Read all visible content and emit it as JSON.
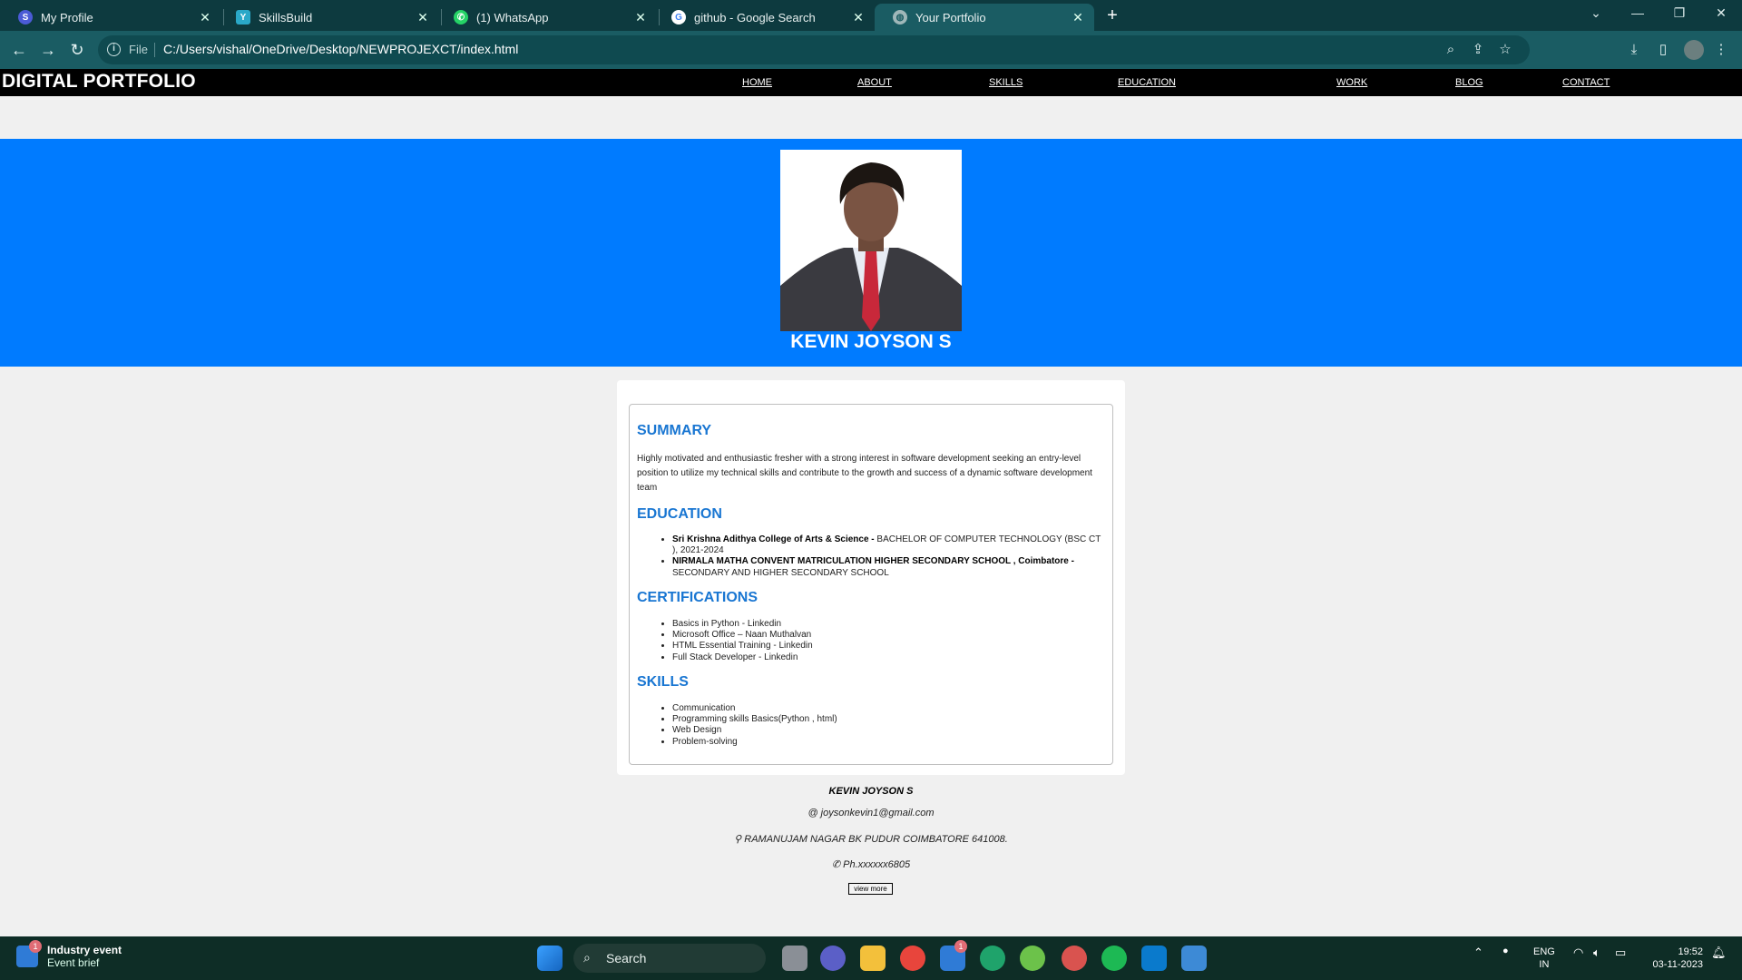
{
  "browser": {
    "tabs": [
      {
        "title": "My Profile",
        "icon": "skillsbuild-icon",
        "color": "#4b5bd6"
      },
      {
        "title": "SkillsBuild",
        "icon": "yl-logo-icon",
        "color": "#2aa8c8"
      },
      {
        "title": "(1) WhatsApp",
        "icon": "whatsapp-icon",
        "color": "#25d366"
      },
      {
        "title": "github - Google Search",
        "icon": "google-icon",
        "color": "#ffffff"
      },
      {
        "title": "Your Portfolio",
        "icon": "globe-icon",
        "color": "#9fb7b9"
      }
    ],
    "address": {
      "scheme": "File",
      "url": "C:/Users/vishal/OneDrive/Desktop/NEWPROJEXCT/index.html"
    }
  },
  "site": {
    "brand": "DIGITAL PORTFOLIO",
    "nav": [
      "HOME",
      "ABOUT",
      "SKILLS",
      "EDUCATION",
      "WORK",
      "BLOG",
      "CONTACT"
    ],
    "hero_name": "KEVIN JOYSON S",
    "colors": {
      "hero": "#007bff",
      "heading": "#1976d2",
      "navbar": "#000000"
    },
    "summary": {
      "heading": "SUMMARY",
      "text": "Highly motivated and enthusiastic fresher with a strong interest in software development seeking an entry-level position to utilize my technical skills and contribute to the growth and success of a dynamic software development team"
    },
    "education": {
      "heading": "EDUCATION",
      "items": [
        {
          "name": "Sri Krishna Adithya College of Arts & Science -",
          "detail": " BACHELOR OF COMPUTER TECHNOLOGY (BSC CT ), 2021-2024"
        },
        {
          "name": "NIRMALA MATHA CONVENT MATRICULATION HIGHER SECONDARY SCHOOL , Coimbatore -",
          "detail": " SECONDARY AND HIGHER SECONDARY SCHOOL"
        }
      ]
    },
    "certifications": {
      "heading": "CERTIFICATIONS",
      "items": [
        "Basics in Python - Linkedin",
        "Microsoft Office – Naan Muthalvan",
        "HTML Essential Training - Linkedin",
        "Full Stack Developer - Linkedin"
      ]
    },
    "skills": {
      "heading": "SKILLS",
      "items": [
        "Communication",
        "Programming skills Basics(Python , html)",
        "Web Design",
        "Problem-solving"
      ]
    },
    "footer": {
      "name": "KEVIN JOYSON S",
      "email": "@ joysonkevin1@gmail.com",
      "address": "⚲ RAMANUJAM NAGAR BK PUDUR COIMBATORE 641008.",
      "phone": "✆ Ph.xxxxxx6805",
      "view_more": "view more"
    }
  },
  "taskbar": {
    "widget_title": "Industry event",
    "widget_subtitle": "Event brief",
    "widget_badge": "1",
    "search": "Search",
    "mail_badge": "1",
    "lang_top": "ENG",
    "lang_bottom": "IN",
    "time": "19:52",
    "date": "03-11-2023"
  }
}
